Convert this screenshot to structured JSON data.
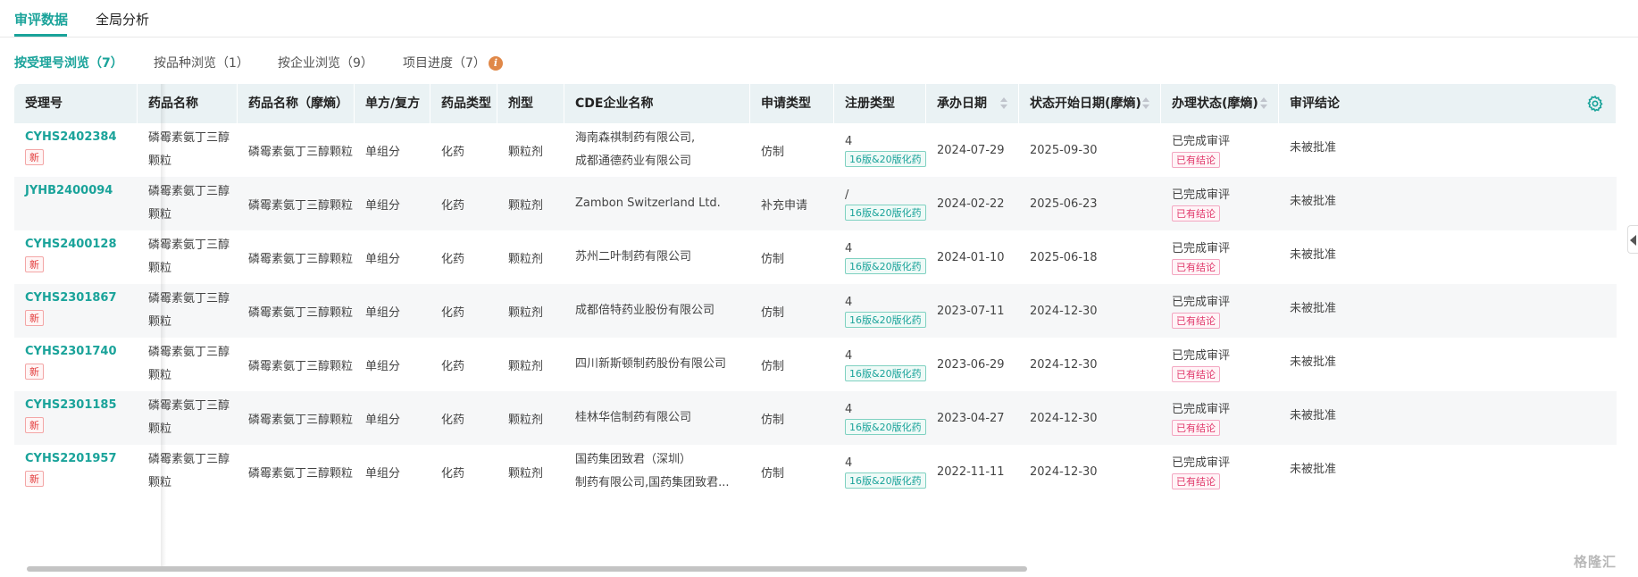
{
  "top_tabs": [
    {
      "label": "审评数据",
      "active": true
    },
    {
      "label": "全局分析",
      "active": false
    }
  ],
  "sub_tabs": [
    {
      "label": "按受理号浏览（7）",
      "active": true
    },
    {
      "label": "按品种浏览（1）",
      "active": false
    },
    {
      "label": "按企业浏览（9）",
      "active": false
    },
    {
      "label": "项目进度（7）",
      "active": false,
      "icon": "info-icon"
    }
  ],
  "info_icon_glyph": "i",
  "table": {
    "headers": [
      "受理号",
      "药品名称",
      "药品名称（摩熵）",
      "单方/复方",
      "药品类型",
      "剂型",
      "CDE企业名称",
      "申请类型",
      "注册类型",
      "承办日期",
      "状态开始日期(摩熵)",
      "办理状态(摩熵)",
      "审评结论"
    ],
    "sortable_columns": [
      "承办日期",
      "状态开始日期(摩熵)",
      "办理状态(摩熵)"
    ],
    "settings_icon": "gear-icon",
    "rows": [
      {
        "id": "CYHS2402384",
        "is_new": true,
        "drug_name": [
          "磷霉素氨丁三醇",
          "颗粒"
        ],
        "drug_name_ms": "磷霉素氨丁三醇颗粒",
        "composition": "单组分",
        "drug_type": "化药",
        "dosage_form": "颗粒剂",
        "company": [
          "海南森祺制药有限公司,",
          "成都通德药业有限公司"
        ],
        "application_type": "仿制",
        "reg_num": "4",
        "reg_tag": "16版&20版化药",
        "accept_date": "2024-07-29",
        "status_start": "2025-09-30",
        "status": "已完成审评",
        "status_tag": "已有结论",
        "conclusion": "未被批准"
      },
      {
        "id": "JYHB2400094",
        "is_new": false,
        "drug_name": [
          "磷霉素氨丁三醇",
          "颗粒"
        ],
        "drug_name_ms": "磷霉素氨丁三醇颗粒",
        "composition": "单组分",
        "drug_type": "化药",
        "dosage_form": "颗粒剂",
        "company": [
          "Zambon Switzerland Ltd."
        ],
        "application_type": "补充申请",
        "reg_num": "/",
        "reg_tag": "16版&20版化药",
        "accept_date": "2024-02-22",
        "status_start": "2025-06-23",
        "status": "已完成审评",
        "status_tag": "已有结论",
        "conclusion": "未被批准"
      },
      {
        "id": "CYHS2400128",
        "is_new": true,
        "drug_name": [
          "磷霉素氨丁三醇",
          "颗粒"
        ],
        "drug_name_ms": "磷霉素氨丁三醇颗粒",
        "composition": "单组分",
        "drug_type": "化药",
        "dosage_form": "颗粒剂",
        "company": [
          "苏州二叶制药有限公司"
        ],
        "application_type": "仿制",
        "reg_num": "4",
        "reg_tag": "16版&20版化药",
        "accept_date": "2024-01-10",
        "status_start": "2025-06-18",
        "status": "已完成审评",
        "status_tag": "已有结论",
        "conclusion": "未被批准"
      },
      {
        "id": "CYHS2301867",
        "is_new": true,
        "drug_name": [
          "磷霉素氨丁三醇",
          "颗粒"
        ],
        "drug_name_ms": "磷霉素氨丁三醇颗粒",
        "composition": "单组分",
        "drug_type": "化药",
        "dosage_form": "颗粒剂",
        "company": [
          "成都倍特药业股份有限公司"
        ],
        "application_type": "仿制",
        "reg_num": "4",
        "reg_tag": "16版&20版化药",
        "accept_date": "2023-07-11",
        "status_start": "2024-12-30",
        "status": "已完成审评",
        "status_tag": "已有结论",
        "conclusion": "未被批准"
      },
      {
        "id": "CYHS2301740",
        "is_new": true,
        "drug_name": [
          "磷霉素氨丁三醇",
          "颗粒"
        ],
        "drug_name_ms": "磷霉素氨丁三醇颗粒",
        "composition": "单组分",
        "drug_type": "化药",
        "dosage_form": "颗粒剂",
        "company": [
          "四川新斯顿制药股份有限公司"
        ],
        "application_type": "仿制",
        "reg_num": "4",
        "reg_tag": "16版&20版化药",
        "accept_date": "2023-06-29",
        "status_start": "2024-12-30",
        "status": "已完成审评",
        "status_tag": "已有结论",
        "conclusion": "未被批准"
      },
      {
        "id": "CYHS2301185",
        "is_new": true,
        "drug_name": [
          "磷霉素氨丁三醇",
          "颗粒"
        ],
        "drug_name_ms": "磷霉素氨丁三醇颗粒",
        "composition": "单组分",
        "drug_type": "化药",
        "dosage_form": "颗粒剂",
        "company": [
          "桂林华信制药有限公司"
        ],
        "application_type": "仿制",
        "reg_num": "4",
        "reg_tag": "16版&20版化药",
        "accept_date": "2023-04-27",
        "status_start": "2024-12-30",
        "status": "已完成审评",
        "status_tag": "已有结论",
        "conclusion": "未被批准"
      },
      {
        "id": "CYHS2201957",
        "is_new": true,
        "drug_name": [
          "磷霉素氨丁三醇",
          "颗粒"
        ],
        "drug_name_ms": "磷霉素氨丁三醇颗粒",
        "composition": "单组分",
        "drug_type": "化药",
        "dosage_form": "颗粒剂",
        "company": [
          "国药集团致君（深圳）",
          "制药有限公司,国药集团致君..."
        ],
        "application_type": "仿制",
        "reg_num": "4",
        "reg_tag": "16版&20版化药",
        "accept_date": "2022-11-11",
        "status_start": "2024-12-30",
        "status": "已完成审评",
        "status_tag": "已有结论",
        "conclusion": "未被批准"
      }
    ]
  },
  "new_badge_label": "新",
  "watermark": "格隆汇",
  "colors": {
    "accent": "#1aa39a",
    "header_bg": "#eaf2f4",
    "new_badge": "#e23c3c",
    "status_tag": "#e0386b"
  }
}
